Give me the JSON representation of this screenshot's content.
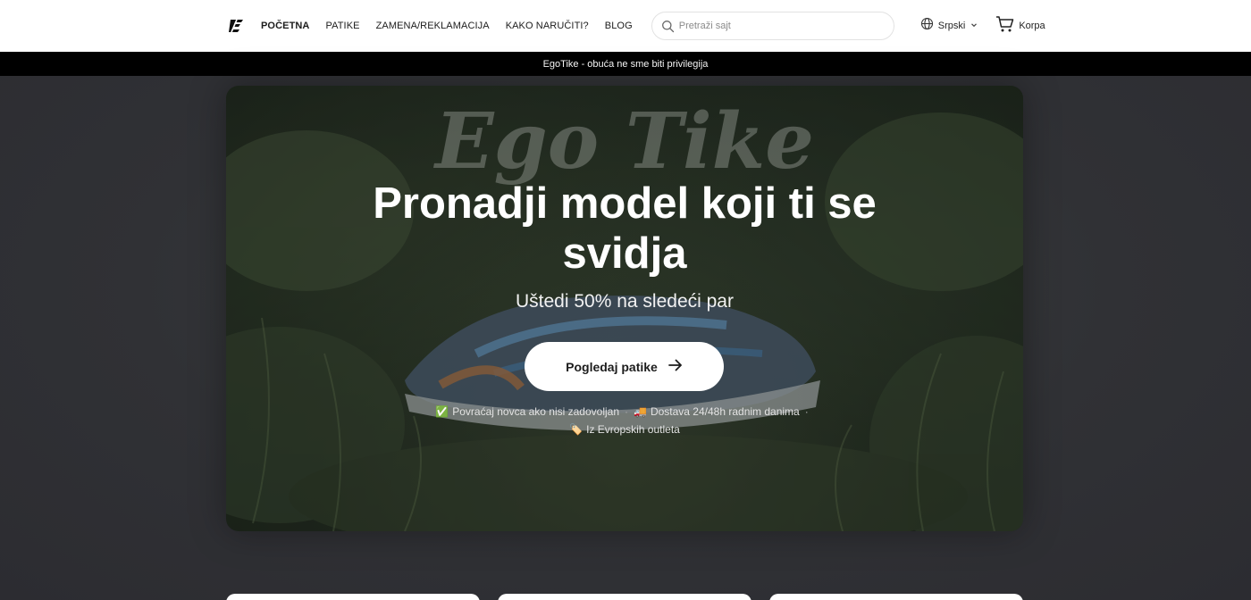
{
  "header": {
    "nav": [
      "POČETNA",
      "PATIKE",
      "ZAMENA/REKLAMACIJA",
      "KAKO NARUČITI?",
      "BLOG"
    ],
    "search_placeholder": "Pretraži sajt",
    "language": "Srpski",
    "cart_label": "Korpa"
  },
  "announcement": "EgoTike - obuća ne sme biti privilegija",
  "hero": {
    "watermark": "Ego Tike",
    "title_line1": "Pronadji model koji ti se",
    "title_line2": "svidja",
    "subtitle": "Uštedi 50% na sledeći par",
    "cta_label": "Pogledaj patike",
    "benefits": [
      {
        "icon": "✅",
        "text": "Povraćaj novca ako nisi zadovoljan"
      },
      {
        "icon": "🚚",
        "text": "Dostava 24/48h radnim danima"
      },
      {
        "icon": "🏷️",
        "text": "Iz Evropskih outleta"
      }
    ]
  },
  "colors": {
    "header_bg": "#ffffff",
    "announcement_bg": "#000000",
    "page_bg": "#2e2e33",
    "cta_bg": "#ffffff"
  }
}
